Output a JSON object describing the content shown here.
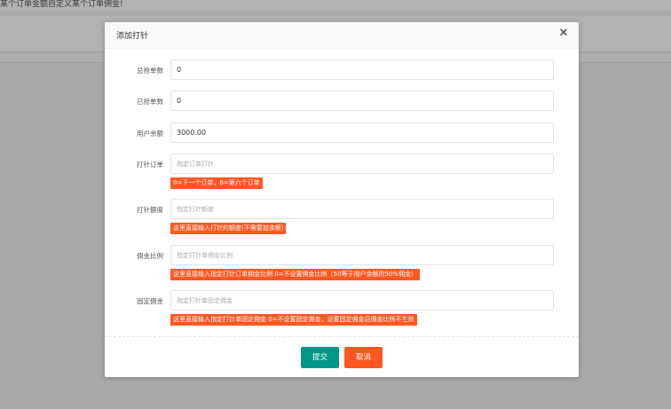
{
  "background": {
    "notice": "某个订单金额自定义某个订单佣金!"
  },
  "modal": {
    "title": "添加打针",
    "close_glyph": "✕",
    "fields": [
      {
        "label": "总抢单数",
        "value": "0",
        "placeholder": ""
      },
      {
        "label": "已抢单数",
        "value": "0",
        "placeholder": ""
      },
      {
        "label": "用户余额",
        "value": "3000.00",
        "placeholder": ""
      },
      {
        "label": "打针订单",
        "value": "",
        "placeholder": "指定订单打针",
        "hint": "0=下一个订单，6=第六个订单"
      },
      {
        "label": "打针额度",
        "value": "",
        "placeholder": "指定打针额度",
        "hint": "这里直接输入打针的额度(不需要加余额)"
      },
      {
        "label": "佣金比例",
        "value": "",
        "placeholder": "指定打针单佣金比例",
        "hint": "这里直接输入指定打针订单佣金比例 0=不设置佣金比例（50等于用户余额的50%佣金）"
      },
      {
        "label": "固定佣金",
        "value": "",
        "placeholder": "指定打针单固定佣金",
        "hint": "这里直接输入指定打针单固定佣金 0=不设置固定佣金，设置固定佣金后佣金比例不生效"
      }
    ],
    "submit_label": "提交",
    "cancel_label": "取消"
  },
  "colors": {
    "submit": "#009688",
    "cancel": "#ff5722",
    "hint": "#ff5722"
  }
}
